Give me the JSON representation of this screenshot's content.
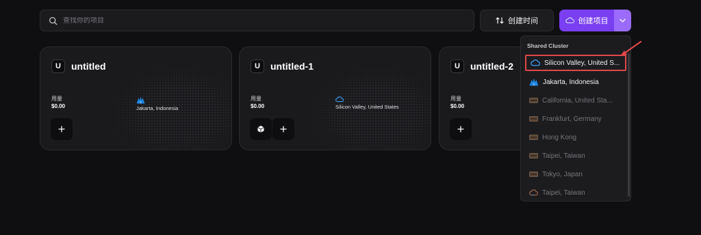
{
  "search": {
    "placeholder": "查找你的项目"
  },
  "toolbar": {
    "sort_label": "创建时间",
    "create_label": "创建项目"
  },
  "projects": [
    {
      "avatar": "U",
      "title": "untitled",
      "usage_label": "用量",
      "usage_value": "$0.00",
      "region": "Jakarta, Indonesia",
      "region_icon": "alibaba-cloud-icon"
    },
    {
      "avatar": "U",
      "title": "untitled-1",
      "usage_label": "用量",
      "usage_value": "$0.00",
      "region": "Silicon Valley, United States",
      "region_icon": "cloud-icon"
    },
    {
      "avatar": "U",
      "title": "untitled-2",
      "usage_label": "用量",
      "usage_value": "$0.00"
    }
  ],
  "dropdown": {
    "header": "Shared Cluster",
    "items": [
      {
        "label": "Silicon Valley, United S...",
        "icon": "cloud-icon",
        "state": "selected"
      },
      {
        "label": "Jakarta, Indonesia",
        "icon": "alibaba-cloud-icon",
        "state": "enabled"
      },
      {
        "label": "California, United Sta...",
        "icon": "server-icon",
        "state": "disabled"
      },
      {
        "label": "Frankfurt, Germany",
        "icon": "server-icon",
        "state": "disabled"
      },
      {
        "label": "Hong Kong",
        "icon": "server-icon",
        "state": "disabled"
      },
      {
        "label": "Taipei, Taiwan",
        "icon": "server-icon",
        "state": "disabled"
      },
      {
        "label": "Tokyo, Japan",
        "icon": "server-icon",
        "state": "disabled"
      },
      {
        "label": "Taipei, Taiwan",
        "icon": "gcp-icon",
        "state": "disabled"
      }
    ]
  },
  "colors": {
    "accent": "#7b3ff2",
    "accent_light": "#9b6bff",
    "highlight": "#e04848",
    "background": "#0f0f11"
  }
}
